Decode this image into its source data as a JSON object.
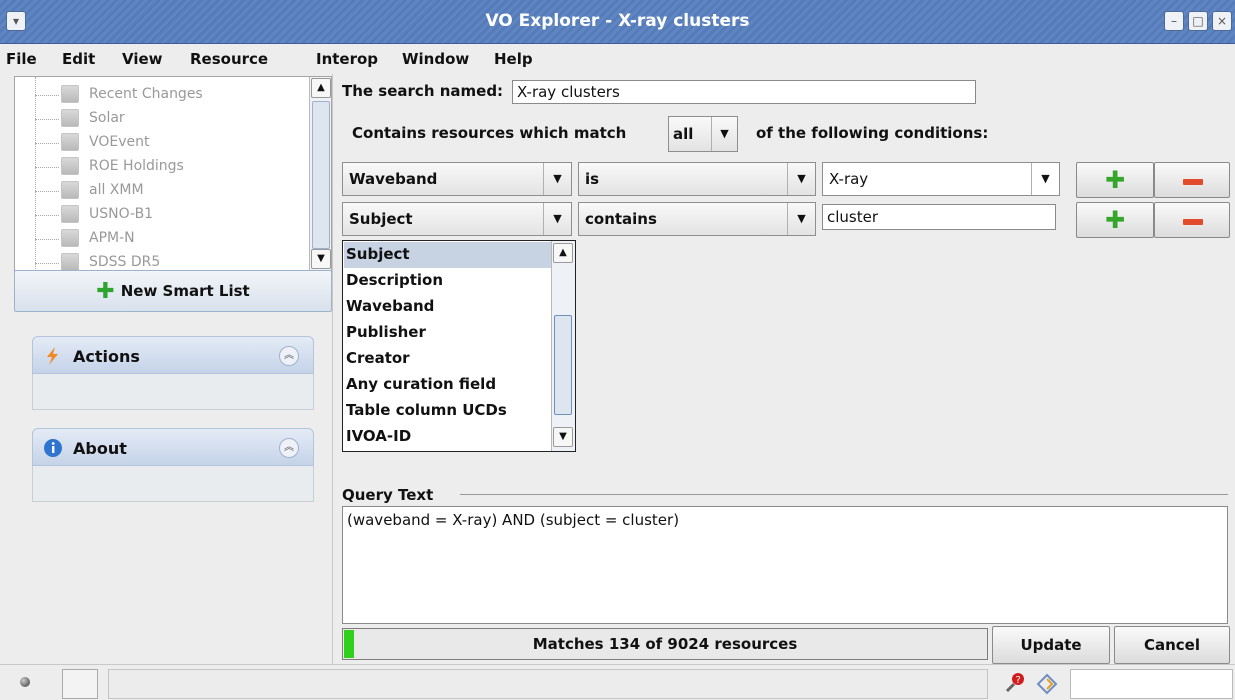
{
  "window": {
    "title": "VO Explorer - X-ray clusters"
  },
  "menu": [
    "File",
    "Edit",
    "View",
    "Resource",
    "Interop",
    "Window",
    "Help"
  ],
  "tree": {
    "items": [
      "Recent Changes",
      "Solar",
      "VOEvent",
      "ROE Holdings",
      "all XMM",
      "USNO-B1",
      "APM-N",
      "SDSS DR5"
    ]
  },
  "left": {
    "new_smart_list": "New Smart List",
    "actions_label": "Actions",
    "about_label": "About"
  },
  "search": {
    "name_label": "The search named:",
    "name_value": "X-ray clusters",
    "contains_prefix": "Contains resources which match",
    "match_value": "all",
    "contains_suffix": "of the following conditions:"
  },
  "conditions": [
    {
      "field": "Waveband",
      "operator": "is",
      "value": "X-ray"
    },
    {
      "field": "Subject",
      "operator": "contains",
      "value": "cluster"
    }
  ],
  "dropdown": {
    "items": [
      "Subject",
      "Description",
      "Waveband",
      "Publisher",
      "Creator",
      "Any curation field",
      "Table column UCDs",
      "IVOA-ID"
    ],
    "selected": "Subject"
  },
  "query": {
    "label": "Query Text",
    "text": "(waveband = X-ray) AND (subject = cluster)"
  },
  "status": {
    "matches_text": "Matches 134 of 9024 resources",
    "progress_fraction": 0.015,
    "update_label": "Update",
    "cancel_label": "Cancel"
  },
  "colors": {
    "titlebar": "#5f86c3",
    "progress": "#2fd11d",
    "plus": "#35a52b",
    "minus": "#e34c2a"
  }
}
